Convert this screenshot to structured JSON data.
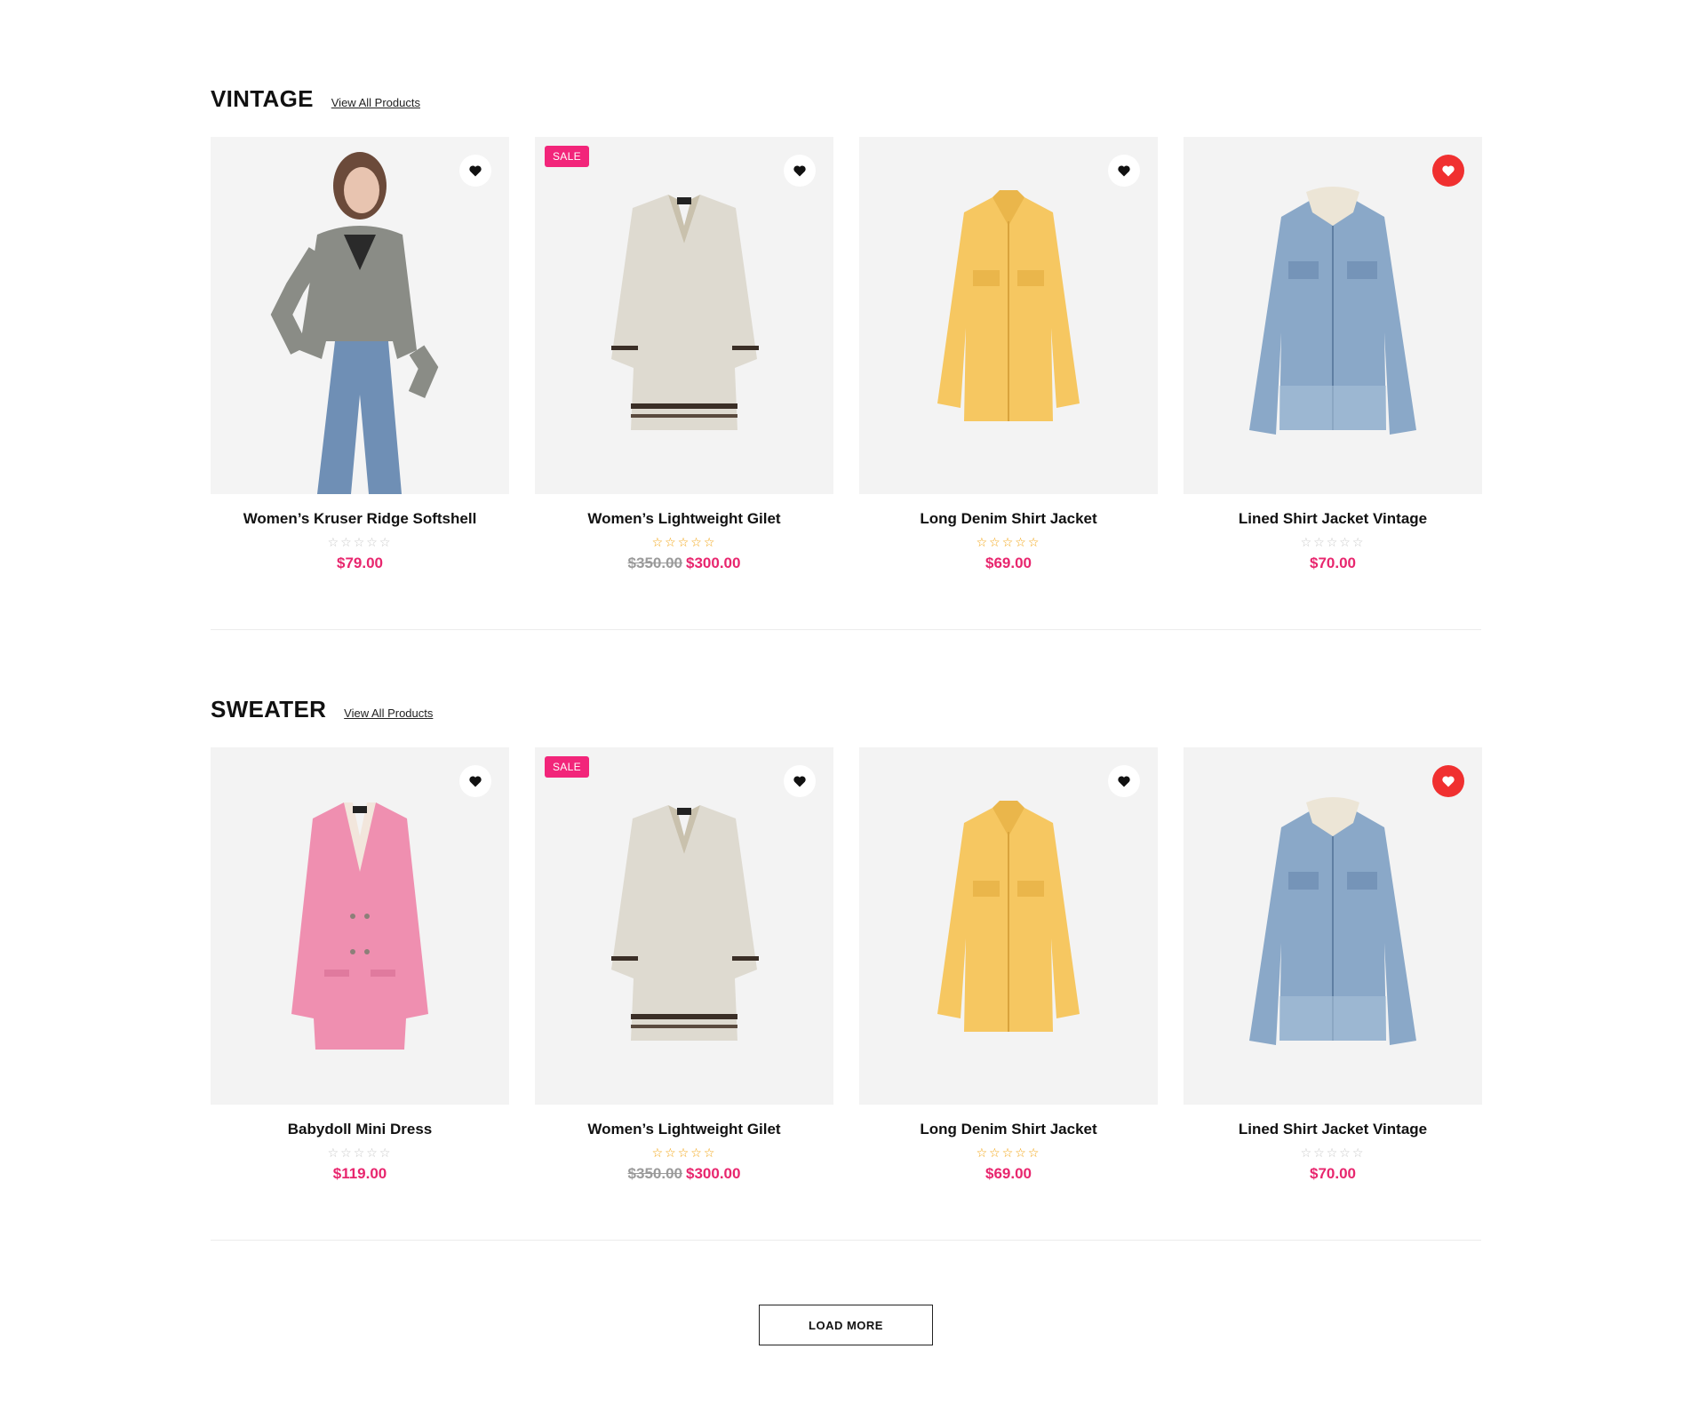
{
  "colors": {
    "accent_pink": "#e8266e",
    "sale_badge": "#f2257a",
    "wishlist_active": "#f03030",
    "star_gold": "#f2a20c",
    "star_empty": "#c9c9c9"
  },
  "sections": [
    {
      "title": "VINTAGE",
      "view_all": "View All Products",
      "products": [
        {
          "name": "Women’s Kruser Ridge Softshell",
          "price": "$79.00",
          "old_price": "",
          "sale": "",
          "rated": false,
          "wishlisted": false,
          "image": "model-grey-cardigan"
        },
        {
          "name": "Women’s Lightweight Gilet",
          "price": "$300.00",
          "old_price": "$350.00",
          "sale": "SALE",
          "rated": true,
          "wishlisted": false,
          "image": "beige-coat"
        },
        {
          "name": "Long Denim Shirt Jacket",
          "price": "$69.00",
          "old_price": "",
          "sale": "",
          "rated": true,
          "wishlisted": false,
          "image": "yellow-jacket"
        },
        {
          "name": "Lined Shirt Jacket Vintage",
          "price": "$70.00",
          "old_price": "",
          "sale": "",
          "rated": false,
          "wishlisted": true,
          "image": "denim-jacket"
        }
      ]
    },
    {
      "title": "SWEATER",
      "view_all": "View All Products",
      "products": [
        {
          "name": "Babydoll Mini Dress",
          "price": "$119.00",
          "old_price": "",
          "sale": "",
          "rated": false,
          "wishlisted": false,
          "image": "pink-blazer"
        },
        {
          "name": "Women’s Lightweight Gilet",
          "price": "$300.00",
          "old_price": "$350.00",
          "sale": "SALE",
          "rated": true,
          "wishlisted": false,
          "image": "beige-coat"
        },
        {
          "name": "Long Denim Shirt Jacket",
          "price": "$69.00",
          "old_price": "",
          "sale": "",
          "rated": true,
          "wishlisted": false,
          "image": "yellow-jacket"
        },
        {
          "name": "Lined Shirt Jacket Vintage",
          "price": "$70.00",
          "old_price": "",
          "sale": "",
          "rated": false,
          "wishlisted": true,
          "image": "denim-jacket"
        }
      ]
    }
  ],
  "load_more": "LOAD MORE",
  "star_glyph": "☆☆☆☆☆"
}
